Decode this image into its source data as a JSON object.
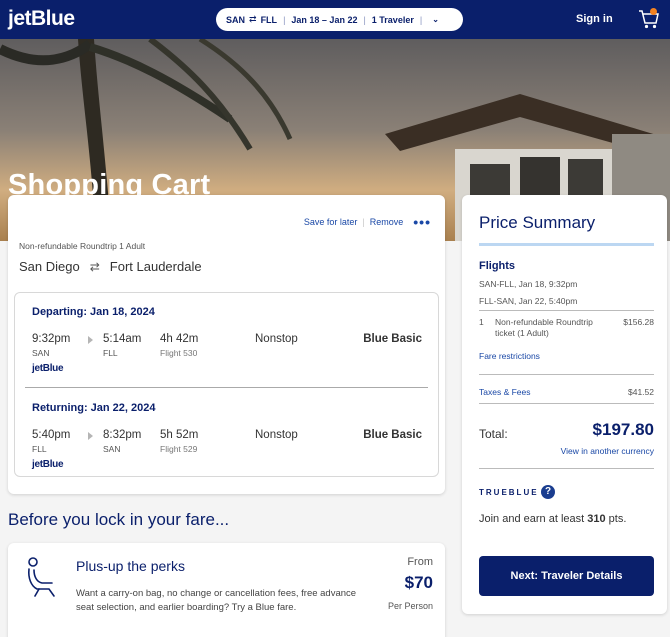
{
  "header": {
    "logo": "jetBlue",
    "trip": {
      "from": "SAN",
      "swap": "⇄",
      "to": "FLL",
      "dates": "Jan 18 – Jan 22",
      "travelers": "1 Traveler",
      "chevron": "⌄"
    },
    "signin": "Sign in",
    "cart_icon": "cart-icon"
  },
  "hero": {
    "title": "Shopping Cart"
  },
  "trip_card": {
    "save_label": "Save for later",
    "remove_label": "Remove",
    "more_label": "•••",
    "fare_note": "Non-refundable Roundtrip 1 Adult",
    "origin": "San Diego",
    "arrows": "⇄",
    "destination": "Fort Lauderdale",
    "legs": [
      {
        "heading": "Departing: Jan 18, 2024",
        "dep_time": "9:32pm",
        "dep_code": "SAN",
        "arr_time": "5:14am",
        "arr_code": "FLL",
        "duration": "4h 42m",
        "flight": "Flight 530",
        "stops": "Nonstop",
        "fare": "Blue Basic",
        "airline": "jetBlue"
      },
      {
        "heading": "Returning: Jan 22, 2024",
        "dep_time": "5:40pm",
        "dep_code": "FLL",
        "arr_time": "8:32pm",
        "arr_code": "SAN",
        "duration": "5h 52m",
        "flight": "Flight 529",
        "stops": "Nonstop",
        "fare": "Blue Basic",
        "airline": "jetBlue"
      }
    ]
  },
  "section": {
    "title": "Before you lock in your fare..."
  },
  "perks": {
    "title": "Plus-up the perks",
    "description": "Want a carry-on bag, no change or cancellation fees, free advance seat selection, and earlier boarding? Try a Blue fare.",
    "from": "From",
    "price": "$70",
    "per": "Per Person"
  },
  "summary": {
    "title": "Price Summary",
    "flights_heading": "Flights",
    "lines": [
      "SAN-FLL, Jan 18, 9:32pm",
      "FLL-SAN, Jan 22, 5:40pm"
    ],
    "item_num": "1",
    "item_desc": "Non-refundable Roundtrip ticket (1 Adult)",
    "item_amount": "$156.28",
    "fare_restrictions": "Fare restrictions",
    "taxes_label": "Taxes & Fees",
    "taxes_amount": "$41.52",
    "total_label": "Total:",
    "total_amount": "$197.80",
    "currency_link": "View in another currency",
    "trueblue": "TRUEBLUE",
    "earn_prefix": "Join and earn at least ",
    "earn_points": "310",
    "earn_suffix": " pts.",
    "next_button": "Next: Traveler Details"
  },
  "colors": {
    "navy": "#0a1f6b",
    "link": "#1a48a6",
    "accent_orange": "#f58220",
    "rule": "#bcd7f2"
  }
}
